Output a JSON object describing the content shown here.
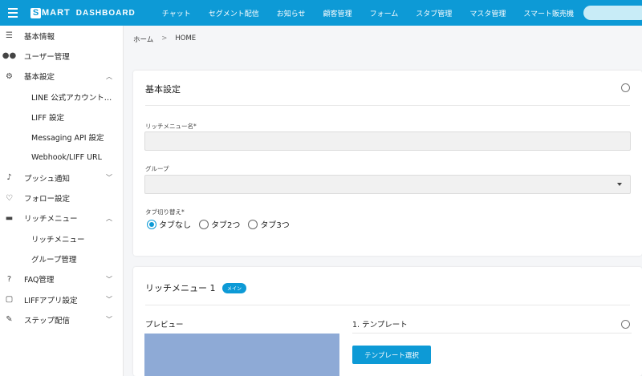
{
  "header": {
    "logo_text": "MART",
    "logo_sub": "DASHBOARD",
    "nav": [
      "チャット",
      "セグメント配信",
      "お知らせ",
      "顧客管理",
      "フォーム",
      "スタブ管理",
      "マスタ管理",
      "スマート販売機"
    ]
  },
  "sidebar": {
    "items": [
      {
        "label": "基本情報",
        "icon": "list-icon",
        "glyph": "☰"
      },
      {
        "label": "ユーザー管理",
        "icon": "users-icon",
        "glyph": "👥"
      },
      {
        "label": "基本設定",
        "icon": "gears-icon",
        "glyph": "⚙",
        "chevron": "up"
      },
      {
        "label": "LINE 公式アカウント…",
        "sub": true
      },
      {
        "label": "LIFF 設定",
        "sub": true
      },
      {
        "label": "Messaging API 設定",
        "sub": true
      },
      {
        "label": "Webhook/LIFF URL",
        "sub": true
      },
      {
        "label": "プッシュ通知",
        "icon": "bell-icon",
        "glyph": "🔔",
        "chevron": "down"
      },
      {
        "label": "フォロー設定",
        "icon": "follow-icon",
        "glyph": "♡"
      },
      {
        "label": "リッチメニュー",
        "icon": "rich-menu-icon",
        "glyph": "▬",
        "chevron": "up"
      },
      {
        "label": "リッチメニュー",
        "sub": true
      },
      {
        "label": "グループ管理",
        "sub": true
      },
      {
        "label": "FAQ管理",
        "icon": "help-icon",
        "glyph": "?",
        "chevron": "down"
      },
      {
        "label": "LIFFアプリ設定",
        "icon": "liff-app-icon",
        "glyph": "▢",
        "chevron": "down"
      },
      {
        "label": "ステップ配信",
        "icon": "step-icon",
        "glyph": "✎",
        "chevron": "down"
      }
    ]
  },
  "breadcrumb": {
    "home": "ホーム",
    "sep": ">",
    "current": "HOME"
  },
  "basic_settings": {
    "title": "基本設定",
    "rich_menu_name_label": "リッチメニュー名*",
    "rich_menu_name_value": "",
    "group_label": "グループ",
    "group_value": "",
    "tab_switch_label": "タブ切り替え*",
    "tab_options": [
      "タブなし",
      "タブ2つ",
      "タブ3つ"
    ],
    "tab_selected": "タブなし"
  },
  "rich_menu_1": {
    "title": "リッチメニュー 1",
    "badge": "メイン",
    "preview_label": "プレビュー",
    "template_label": "1. テンプレート",
    "template_button": "テンプレート選択"
  },
  "colors": {
    "accent": "#0d9ad6",
    "preview": "#8eaad6"
  }
}
